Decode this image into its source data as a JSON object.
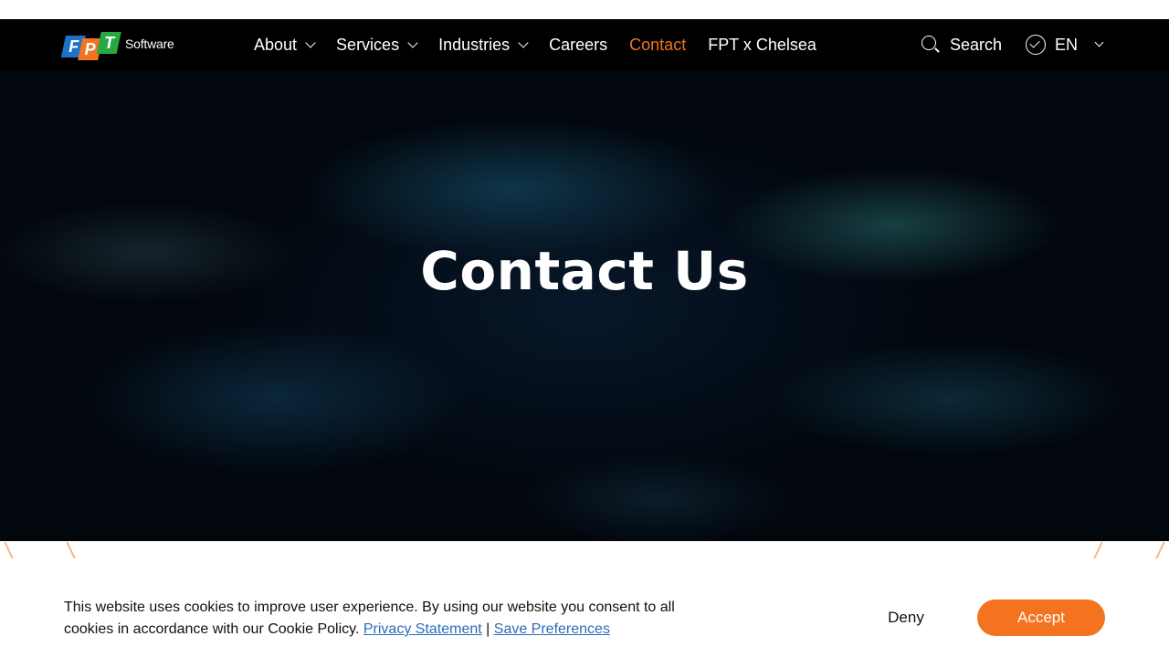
{
  "header": {
    "logo": {
      "letters": [
        "F",
        "P",
        "T"
      ],
      "wordmark": "Software",
      "colors": [
        "#1a73c8",
        "#f47320",
        "#27a844"
      ]
    },
    "nav": [
      {
        "label": "About",
        "has_dropdown": true,
        "active": false
      },
      {
        "label": "Services",
        "has_dropdown": true,
        "active": false
      },
      {
        "label": "Industries",
        "has_dropdown": true,
        "active": false
      },
      {
        "label": "Careers",
        "has_dropdown": false,
        "active": false
      },
      {
        "label": "Contact",
        "has_dropdown": false,
        "active": true
      },
      {
        "label": "FPT x Chelsea",
        "has_dropdown": false,
        "active": false
      }
    ],
    "search_label": "Search",
    "search_icon": "search-icon",
    "language": {
      "label": "EN",
      "icon": "globe-icon"
    }
  },
  "hero": {
    "title": "Contact Us"
  },
  "cookie_banner": {
    "message": "This website uses cookies to improve user experience. By using our website you consent to all cookies in accordance with our Cookie Policy.",
    "privacy_link": "Privacy Statement",
    "separator": "|",
    "preferences_link": "Save Preferences",
    "deny_label": "Deny",
    "accept_label": "Accept"
  },
  "colors": {
    "accent": "#f47320",
    "nav_background": "#000000",
    "link": "#2a6db7"
  }
}
